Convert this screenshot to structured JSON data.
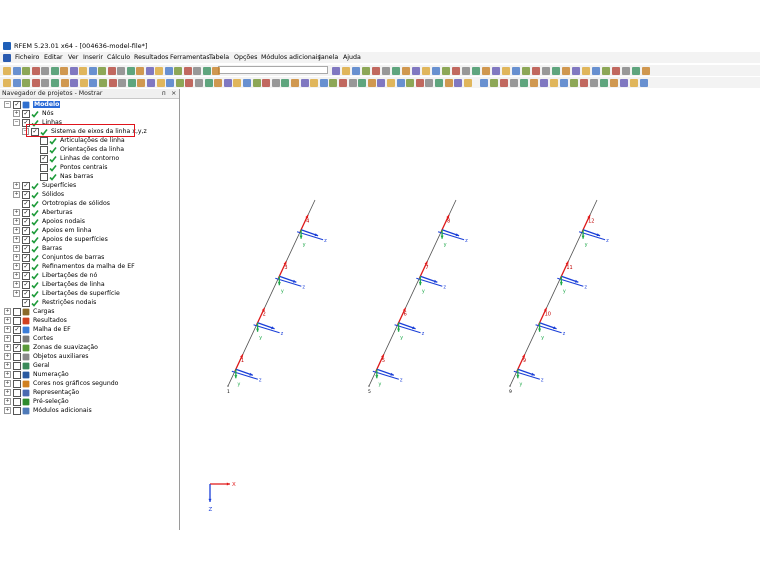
{
  "window": {
    "title": "RFEM 5.23.01 x64 - [004636-model-file*]"
  },
  "menu": [
    "Ficheiro",
    "Editar",
    "Ver",
    "Inserir",
    "Cálculo",
    "Resultados",
    "Ferramentas",
    "Tabela",
    "Opções",
    "Módulos adicionais",
    "Janela",
    "Ajuda"
  ],
  "navigator": {
    "title": "Navegador de projetos - Mostrar",
    "pin_glyph": "ᴨ",
    "close_glyph": "×",
    "items": [
      {
        "label": "Modelo",
        "level": 0,
        "checked": true,
        "expanded": true,
        "selected": true,
        "icon": "model-icon"
      },
      {
        "label": "Nós",
        "level": 1,
        "checked": true,
        "expanded": false,
        "icon": "check-icon"
      },
      {
        "label": "Linhas",
        "level": 1,
        "checked": true,
        "expanded": true,
        "icon": "check-icon"
      },
      {
        "label": "Sistema de eixos da linha x,y,z",
        "level": 2,
        "checked": true,
        "expanded": true,
        "icon": "check-icon"
      },
      {
        "label": "Articulações de linha",
        "level": 3,
        "checked": false,
        "icon": "check-icon"
      },
      {
        "label": "Orientações da linha",
        "level": 3,
        "checked": false,
        "icon": "check-icon"
      },
      {
        "label": "Linhas de contorno",
        "level": 3,
        "checked": true,
        "icon": "check-icon"
      },
      {
        "label": "Pontos centrais",
        "level": 3,
        "checked": false,
        "icon": "check-icon"
      },
      {
        "label": "Nas barras",
        "level": 3,
        "checked": false,
        "icon": "check-icon"
      },
      {
        "label": "Superfícies",
        "level": 1,
        "checked": true,
        "expanded": false,
        "icon": "check-icon"
      },
      {
        "label": "Sólidos",
        "level": 1,
        "checked": true,
        "expanded": false,
        "icon": "check-icon"
      },
      {
        "label": "Ortotropias de sólidos",
        "level": 1,
        "checked": true,
        "icon": "check-icon"
      },
      {
        "label": "Aberturas",
        "level": 1,
        "checked": true,
        "expanded": false,
        "icon": "check-icon"
      },
      {
        "label": "Apoios nodais",
        "level": 1,
        "checked": true,
        "expanded": false,
        "icon": "check-icon"
      },
      {
        "label": "Apoios em linha",
        "level": 1,
        "checked": true,
        "expanded": false,
        "icon": "check-icon"
      },
      {
        "label": "Apoios de superfícies",
        "level": 1,
        "checked": true,
        "expanded": false,
        "icon": "check-icon"
      },
      {
        "label": "Barras",
        "level": 1,
        "checked": true,
        "expanded": false,
        "icon": "check-icon"
      },
      {
        "label": "Conjuntos de barras",
        "level": 1,
        "checked": true,
        "expanded": false,
        "icon": "check-icon"
      },
      {
        "label": "Refinamentos da malha de EF",
        "level": 1,
        "checked": true,
        "expanded": false,
        "icon": "check-icon"
      },
      {
        "label": "Libertações de nó",
        "level": 1,
        "checked": true,
        "expanded": false,
        "icon": "check-icon"
      },
      {
        "label": "Libertações de linha",
        "level": 1,
        "checked": true,
        "expanded": false,
        "icon": "check-icon"
      },
      {
        "label": "Libertações de superfície",
        "level": 1,
        "checked": true,
        "expanded": false,
        "icon": "check-icon"
      },
      {
        "label": "Restrições nodais",
        "level": 1,
        "checked": true,
        "icon": "check-icon"
      },
      {
        "label": "Cargas",
        "level": 0,
        "checked": false,
        "expanded": false,
        "icon": "loads-icon"
      },
      {
        "label": "Resultados",
        "level": 0,
        "checked": false,
        "expanded": false,
        "icon": "results-icon"
      },
      {
        "label": "Malha de EF",
        "level": 0,
        "checked": true,
        "expanded": false,
        "icon": "mesh-icon"
      },
      {
        "label": "Cortes",
        "level": 0,
        "checked": false,
        "expanded": false,
        "icon": "section-icon"
      },
      {
        "label": "Zonas de suavização",
        "level": 0,
        "checked": true,
        "expanded": false,
        "icon": "smoothing-icon"
      },
      {
        "label": "Objetos auxiliares",
        "level": 0,
        "checked": false,
        "expanded": false,
        "icon": "guide-icon"
      },
      {
        "label": "Geral",
        "level": 0,
        "checked": false,
        "expanded": false,
        "icon": "general-icon"
      },
      {
        "label": "Numeração",
        "level": 0,
        "checked": false,
        "expanded": false,
        "icon": "numbering-icon"
      },
      {
        "label": "Cores nos gráficos segundo",
        "level": 0,
        "checked": false,
        "expanded": false,
        "icon": "colors-icon"
      },
      {
        "label": "Representação",
        "level": 0,
        "checked": false,
        "expanded": false,
        "icon": "display-icon"
      },
      {
        "label": "Pré-seleção",
        "level": 0,
        "checked": false,
        "expanded": false,
        "icon": "preselection-icon"
      },
      {
        "label": "Módulos adicionais",
        "level": 0,
        "checked": false,
        "expanded": false,
        "icon": "addon-icon"
      }
    ]
  },
  "viewport": {
    "line_labels": [
      "1",
      "2",
      "3",
      "4",
      "5",
      "6",
      "7",
      "8",
      "9",
      "10",
      "11",
      "12"
    ],
    "node_labels": [
      "1",
      "5",
      "9"
    ],
    "local_axis_labels": {
      "y": "y",
      "z": "z"
    },
    "global_axes": {
      "x": "X",
      "z": "Z"
    },
    "colors": {
      "line": "#505050",
      "x_axis": "#e01818",
      "y_axis": "#1fa84a",
      "z_axis": "#1a3fd8",
      "label": "#c00000"
    }
  }
}
